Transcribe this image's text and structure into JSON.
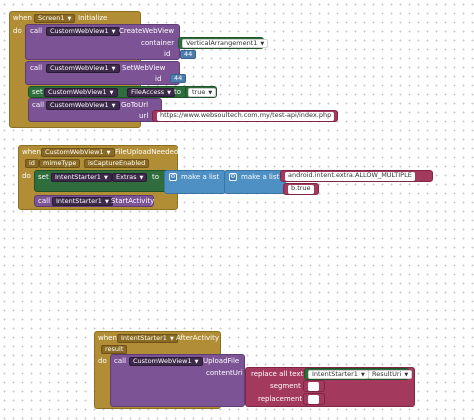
{
  "blocks": {
    "screen_init": {
      "when": "when",
      "component": "Screen1",
      "event": "Initialize",
      "do": "do",
      "call1": {
        "call": "call",
        "component": "CustomWebView1",
        "method": "CreateWebView",
        "param_container": "container",
        "container_value": "VerticalArrangement1",
        "param_id": "id",
        "id_value": "44"
      },
      "call2": {
        "call": "call",
        "component": "CustomWebView1",
        "method": "SetWebView",
        "param_id": "id",
        "id_value": "44"
      },
      "set1": {
        "set": "set",
        "component": "CustomWebView1",
        "property": "FileAccess",
        "to": "to",
        "value": "true"
      },
      "call3": {
        "call": "call",
        "component": "CustomWebView1",
        "method": "GoToUrl",
        "param_url": "url",
        "url_value": "https://www.websoultech.com.my/test-api/index.php"
      }
    },
    "file_upload": {
      "when": "when",
      "component": "CustomWebView1",
      "event": "FileUploadNeeded",
      "param1": "id",
      "param2": "mimeType",
      "param3": "isCaptureEnabled",
      "do": "do",
      "set1": {
        "set": "set",
        "component": "IntentStarter1",
        "property": "Extras",
        "to": "to",
        "make_list_1": "make a list",
        "make_list_2": "make a list",
        "item1": "android.intent.extra.ALLOW_MULTIPLE",
        "item2": "b.true"
      },
      "call1": {
        "call": "call",
        "component": "IntentStarter1",
        "method": "StartActivity"
      }
    },
    "after_activity": {
      "when": "when",
      "component": "IntentStarter1",
      "event": "AfterActivity",
      "param1": "result",
      "do": "do",
      "call1": {
        "call": "call",
        "component": "CustomWebView1",
        "method": "UploadFile",
        "param_content": "contentUri"
      },
      "replace": {
        "label": "replace all text",
        "component": "IntentStarter1",
        "property": "ResultUri",
        "param_segment": "segment",
        "param_replacement": "replacement"
      }
    }
  },
  "colors": {
    "event": "#b18e35",
    "method": "#7c5394",
    "setter": "#2f6e3c",
    "list": "#4e8fc4",
    "text": "#a33a5e",
    "number": "#4f7dad"
  }
}
